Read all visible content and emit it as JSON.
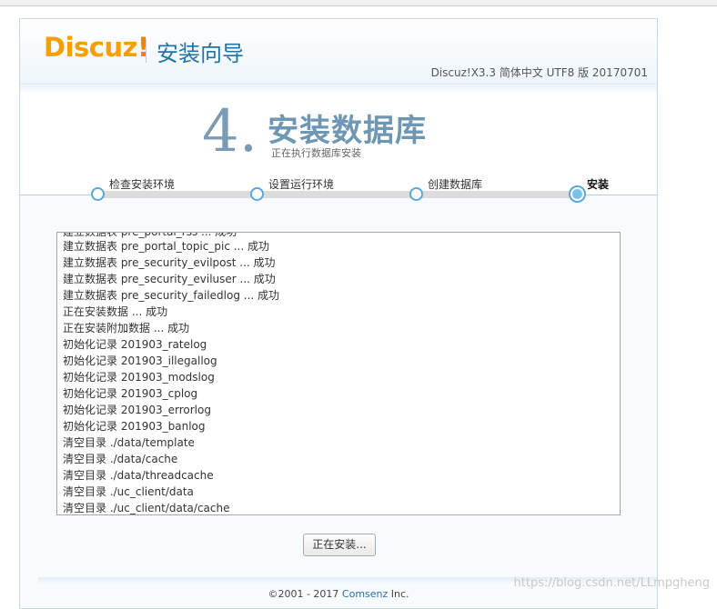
{
  "header": {
    "logo_text": "Discuz",
    "logo_exclaim": "!",
    "title": "安装向导",
    "version": "Discuz!X3.3 简体中文 UTF8 版 20170701"
  },
  "step": {
    "number": "4.",
    "title": "安装数据库",
    "subtitle": "正在执行数据库安装"
  },
  "progress": {
    "steps": [
      {
        "label": "检查安装环境",
        "active": false
      },
      {
        "label": "设置运行环境",
        "active": false
      },
      {
        "label": "创建数据库",
        "active": false
      },
      {
        "label": "安装",
        "active": true
      }
    ]
  },
  "log": {
    "partial_line": "建立数据表 pre_portal_rss ... 成功",
    "lines": [
      "建立数据表 pre_portal_topic_pic ... 成功",
      "建立数据表 pre_security_evilpost ... 成功",
      "建立数据表 pre_security_eviluser ... 成功",
      "建立数据表 pre_security_failedlog ... 成功",
      "正在安装数据 ... 成功",
      "正在安装附加数据 ... 成功",
      "初始化记录 201903_ratelog",
      "初始化记录 201903_illegallog",
      "初始化记录 201903_modslog",
      "初始化记录 201903_cplog",
      "初始化记录 201903_errorlog",
      "初始化记录 201903_banlog",
      "清空目录 ./data/template",
      "清空目录 ./data/cache",
      "清空目录 ./data/threadcache",
      "清空目录 ./uc_client/data",
      "清空目录 ./uc_client/data/cache"
    ]
  },
  "button": {
    "label": "正在安装..."
  },
  "footer": {
    "prefix": "©2001 - 2017 ",
    "company": "Comsenz",
    "suffix": " Inc."
  },
  "watermark": "https://blog.csdn.net/LLmpgheng"
}
